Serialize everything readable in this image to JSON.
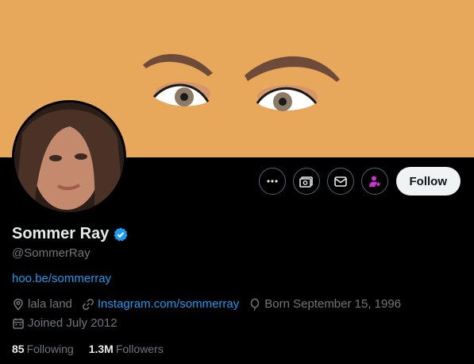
{
  "profile": {
    "display_name": "Sommer Ray",
    "handle": "@SommerRay",
    "verified": true,
    "bio_link": "hoo.be/sommerray",
    "location": "lala land",
    "website": "Instagram.com/sommerray",
    "birthday": "Born September 15, 1996",
    "joined": "Joined July 2012",
    "following_count": "85",
    "following_label": "Following",
    "followers_count": "1.3M",
    "followers_label": "Followers"
  },
  "actions": {
    "follow_label": "Follow",
    "more_icon": "more-icon",
    "subscribe_icon": "subscribe-icon",
    "message_icon": "message-icon",
    "notify_icon": "person-star-icon"
  },
  "colors": {
    "banner": "#e8a85c",
    "accent": "#1d9bf0",
    "verified": "#1d9bf0",
    "purple": "#c936c9"
  }
}
